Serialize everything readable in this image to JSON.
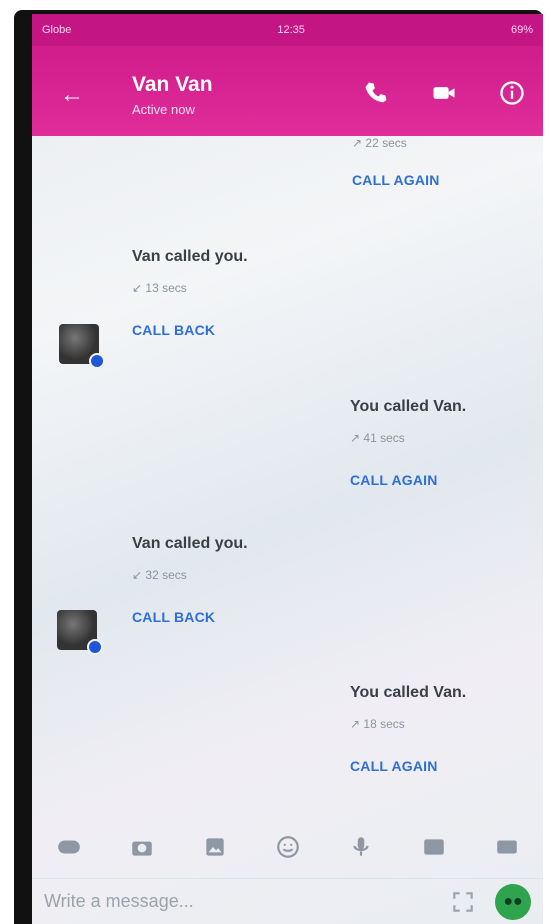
{
  "status": {
    "carrier": "Globe",
    "time": "12:35",
    "battery": "69%"
  },
  "header": {
    "title": "Van Van",
    "subtitle": "Active now",
    "back_label": "←"
  },
  "messages": [
    {
      "side": "right",
      "name": "",
      "meta": "↗ 22 secs",
      "action": "CALL AGAIN"
    },
    {
      "side": "left",
      "name": "Van called you.",
      "meta": "↙ 13 secs",
      "action": "CALL BACK"
    },
    {
      "side": "right",
      "name": "You called Van.",
      "meta": "↗ 41 secs",
      "action": "CALL AGAIN"
    },
    {
      "side": "left",
      "name": "Van called you.",
      "meta": "↙ 32 secs",
      "action": "CALL BACK"
    },
    {
      "side": "right",
      "name": "You called Van.",
      "meta": "↗ 18 secs",
      "action": "CALL AGAIN"
    }
  ],
  "composer": {
    "placeholder": "Write a message..."
  },
  "icons": {
    "phone": "phone-icon",
    "video": "video-icon",
    "info": "info-icon"
  },
  "colors": {
    "accent": "#d11c8c",
    "link": "#2f6ed3"
  }
}
